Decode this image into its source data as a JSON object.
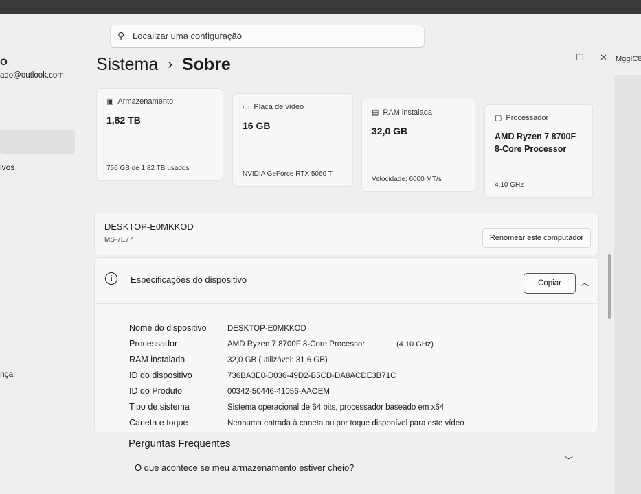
{
  "search": {
    "placeholder": "Localizar uma configuração",
    "icon": "search-icon"
  },
  "window_controls": {
    "minimize": "—",
    "maximize": "☐",
    "close": "✕"
  },
  "user_tag": "MggIC8",
  "sidebar": {
    "account_name": "O",
    "account_email": "ado@outlook.com",
    "items": [
      {
        "label": "ivos"
      },
      {
        "label": "nça"
      }
    ]
  },
  "breadcrumb": {
    "parent": "Sistema",
    "separator": "›",
    "current": "Sobre"
  },
  "cards": [
    {
      "label": "Armazenamento",
      "value": "1,82 TB",
      "sub": "756 GB de 1,82 TB usados",
      "icon": "storage-icon"
    },
    {
      "label": "Placa de vídeo",
      "value": "16 GB",
      "sub": "NVIDIA GeForce RTX 5060 Ti",
      "icon": "gpu-icon"
    },
    {
      "label": "RAM instalada",
      "value": "32,0 GB",
      "sub": "Velocidade: 6000 MT/s",
      "icon": "ram-icon"
    },
    {
      "label": "Processador",
      "value": "AMD Ryzen 7 8700F 8-Core Processor",
      "sub": "4.10 GHz",
      "icon": "cpu-icon"
    }
  ],
  "device": {
    "name": "DESKTOP-E0MKKOD",
    "model": "MS-7E77",
    "rename_label": "Renomear este computador"
  },
  "specs": {
    "title": "Especificações do dispositivo",
    "copy_label": "Copiar",
    "rows": [
      {
        "key": "Nome do dispositivo",
        "value": "DESKTOP-E0MKKOD",
        "extra": ""
      },
      {
        "key": "Processador",
        "value": "AMD Ryzen 7 8700F 8-Core Processor",
        "extra": "(4.10 GHz)"
      },
      {
        "key": "RAM instalada",
        "value": "32,0 GB (utilizável: 31,6 GB)",
        "extra": ""
      },
      {
        "key": "ID do dispositivo",
        "value": "736BA3E0-D036-49D2-B5CD-DA8ACDE3B71C",
        "extra": ""
      },
      {
        "key": "ID do Produto",
        "value": "00342-50446-41056-AAOEM",
        "extra": ""
      },
      {
        "key": "Tipo de sistema",
        "value": "Sistema operacional de 64 bits, processador baseado em x64",
        "extra": ""
      },
      {
        "key": "Caneta e toque",
        "value": "Nenhuma entrada à caneta ou por toque disponível para este vídeo",
        "extra": ""
      }
    ]
  },
  "faq": {
    "title": "Perguntas Frequentes",
    "question": "O que acontece se meu armazenamento estiver cheio?"
  }
}
